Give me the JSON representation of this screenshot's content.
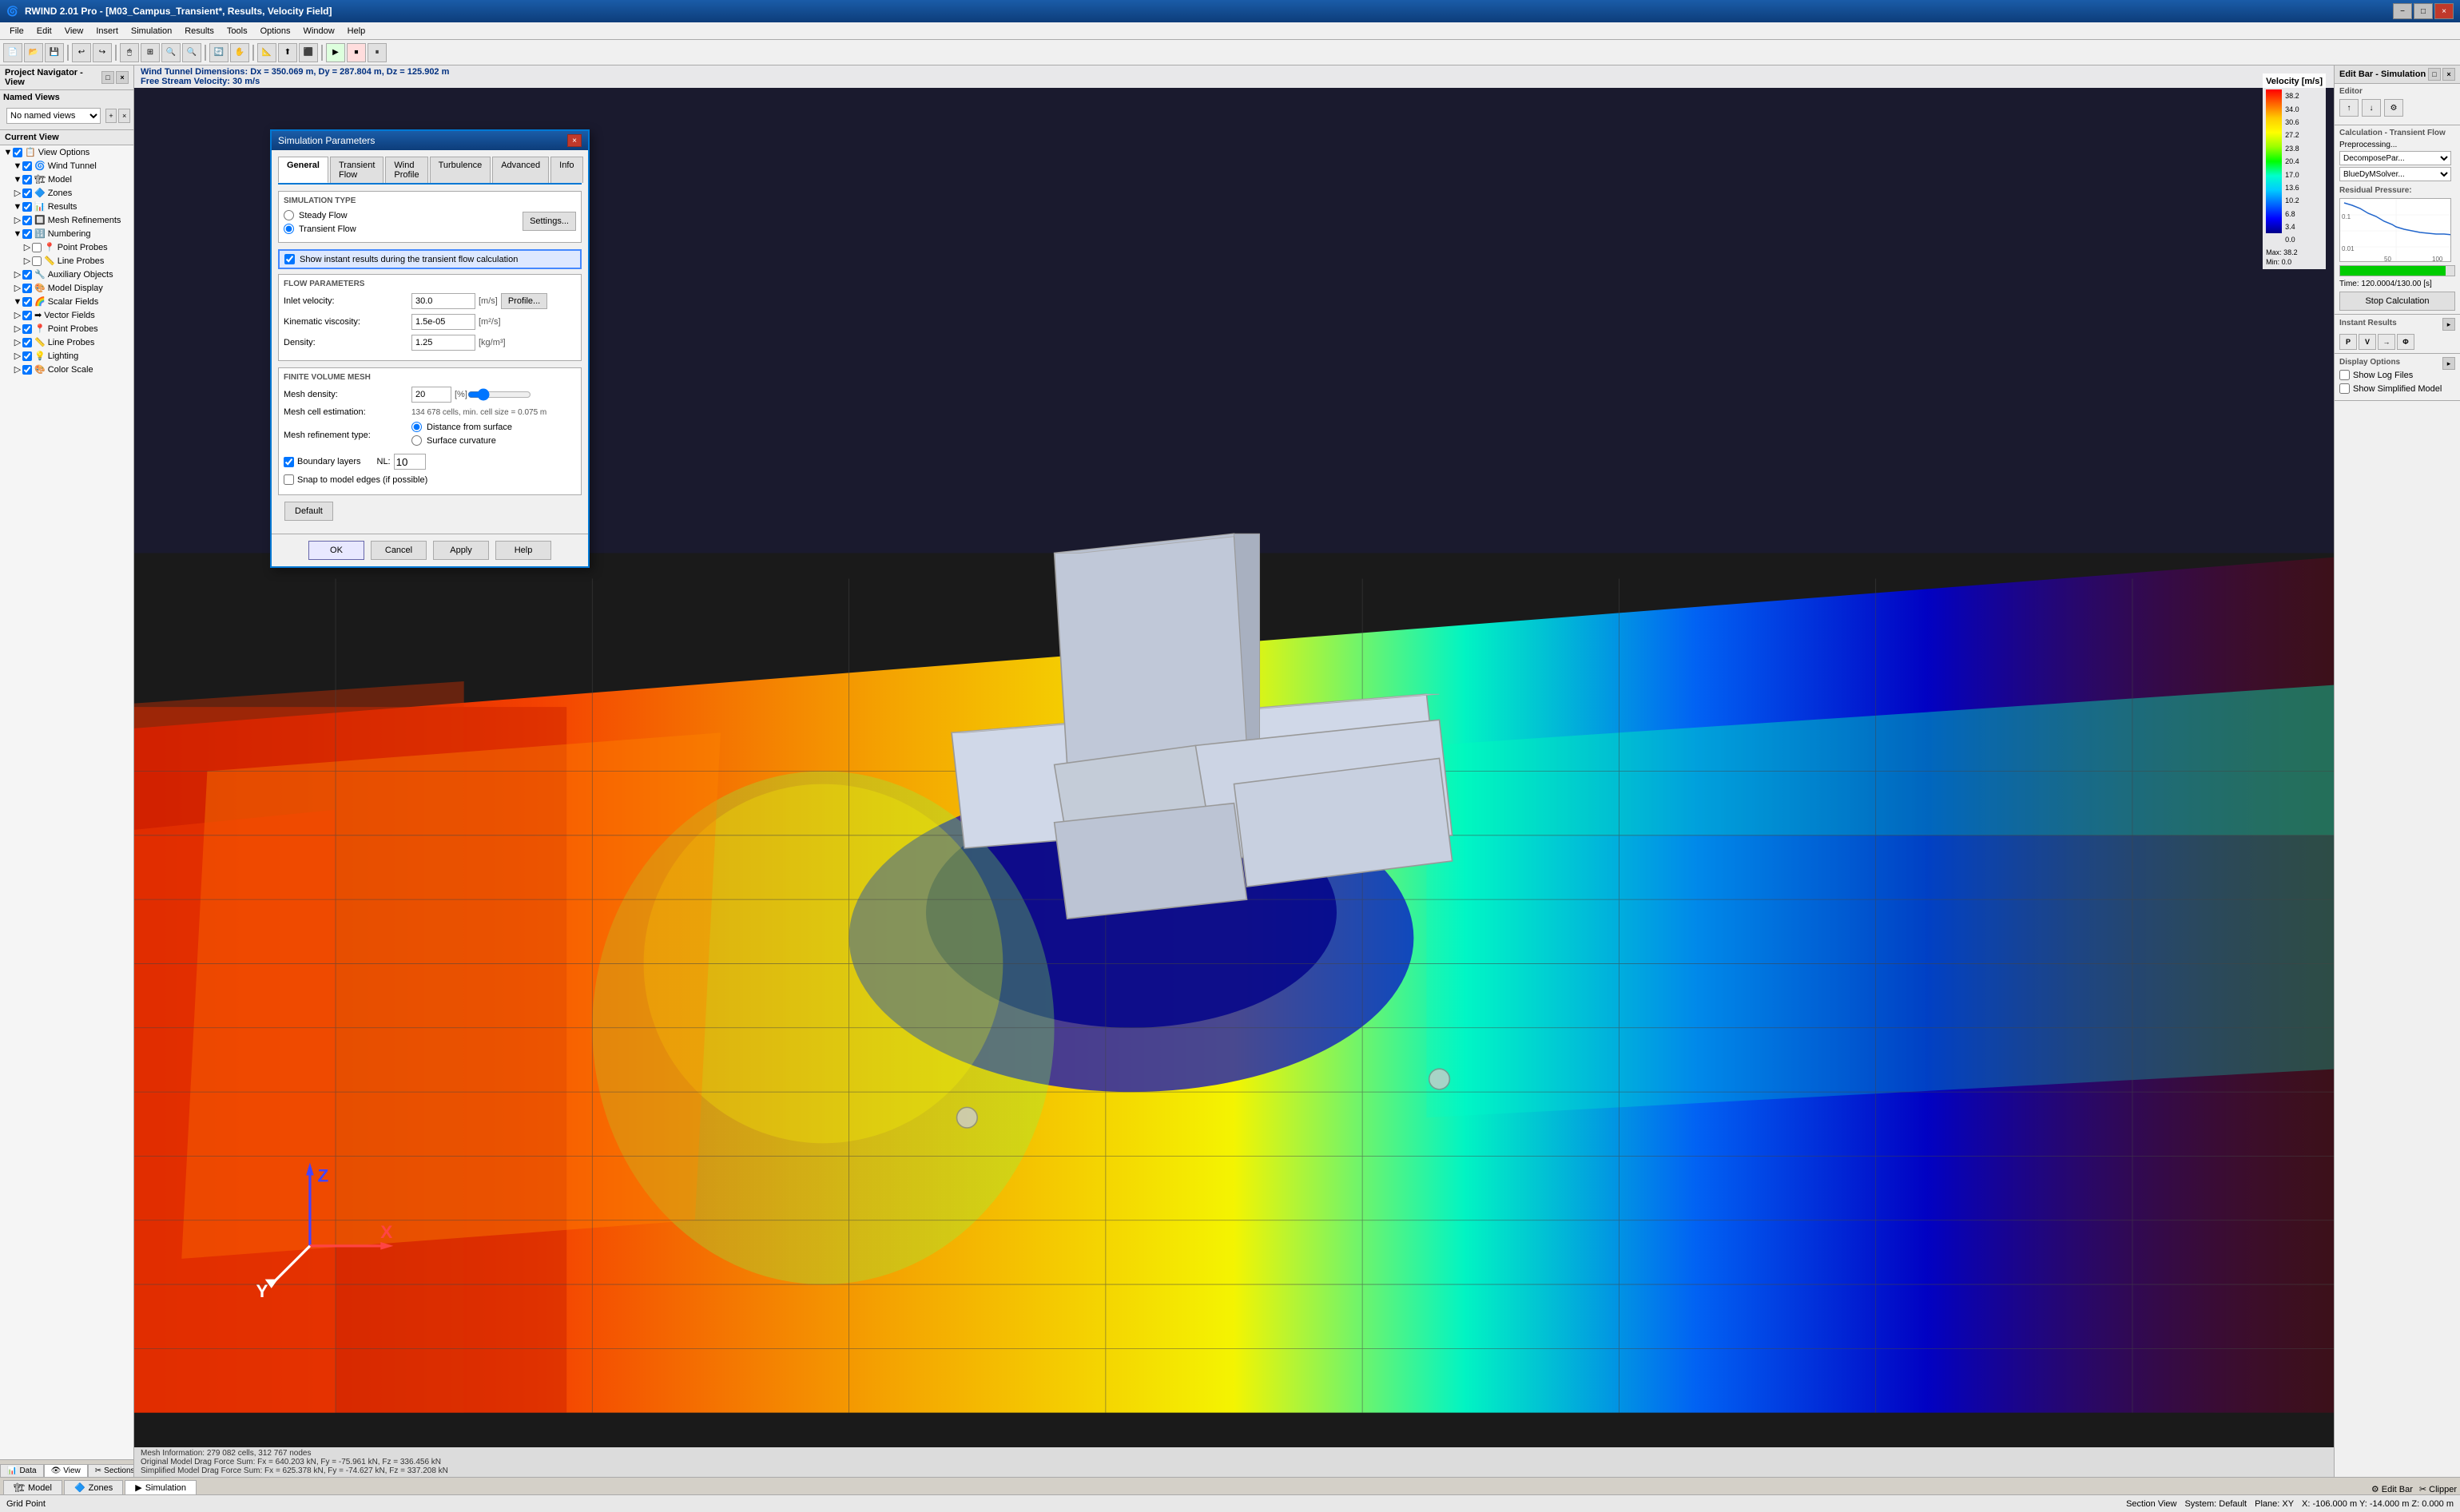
{
  "window": {
    "title": "RWIND 2.01 Pro - [M03_Campus_Transient*, Results, Velocity Field]",
    "minimize": "−",
    "maximize": "□",
    "close": "×"
  },
  "menu": {
    "items": [
      "File",
      "Edit",
      "View",
      "Insert",
      "Simulation",
      "Results",
      "Tools",
      "Options",
      "Window",
      "Help"
    ]
  },
  "info_bar": {
    "dimensions": "Wind Tunnel Dimensions: Dx = 350.069 m, Dy = 287.804 m, Dz = 125.902 m",
    "velocity": "Free Stream Velocity: 30 m/s"
  },
  "velocity_legend": {
    "title": "Velocity [m/s]",
    "values": [
      "38.2",
      "34.0",
      "30.6",
      "27.2",
      "23.8",
      "20.4",
      "17.0",
      "13.6",
      "10.2",
      "6.8",
      "3.4",
      "0.0"
    ],
    "max": "Max: 38.2",
    "min": "Min:  0.0"
  },
  "left_panel": {
    "header": "Project Navigator - View",
    "named_views_label": "Named Views",
    "named_views_value": "No named views",
    "current_view_label": "Current View",
    "tree_items": [
      {
        "label": "View Options",
        "depth": 0,
        "has_checkbox": true,
        "checked": true
      },
      {
        "label": "Wind Tunnel",
        "depth": 1,
        "has_checkbox": true,
        "checked": true
      },
      {
        "label": "Model",
        "depth": 1,
        "has_checkbox": true,
        "checked": true
      },
      {
        "label": "Zones",
        "depth": 1,
        "has_checkbox": true,
        "checked": true
      },
      {
        "label": "Results",
        "depth": 1,
        "has_checkbox": true,
        "checked": true
      },
      {
        "label": "Mesh Refinements",
        "depth": 1,
        "has_checkbox": true,
        "checked": true
      },
      {
        "label": "Numbering",
        "depth": 1,
        "has_checkbox": true,
        "checked": true
      },
      {
        "label": "Point Probes",
        "depth": 2,
        "has_checkbox": true,
        "checked": false
      },
      {
        "label": "Line Probes",
        "depth": 2,
        "has_checkbox": true,
        "checked": false
      },
      {
        "label": "Auxiliary Objects",
        "depth": 1,
        "has_checkbox": true,
        "checked": true
      },
      {
        "label": "Model Display",
        "depth": 1,
        "has_checkbox": true,
        "checked": true
      },
      {
        "label": "Scalar Fields",
        "depth": 1,
        "has_checkbox": true,
        "checked": true
      },
      {
        "label": "Vector Fields",
        "depth": 1,
        "has_checkbox": true,
        "checked": true
      },
      {
        "label": "Point Probes",
        "depth": 1,
        "has_checkbox": true,
        "checked": true
      },
      {
        "label": "Line Probes",
        "depth": 1,
        "has_checkbox": true,
        "checked": true
      },
      {
        "label": "Lighting",
        "depth": 1,
        "has_checkbox": true,
        "checked": true
      },
      {
        "label": "Color Scale",
        "depth": 1,
        "has_checkbox": true,
        "checked": true
      }
    ],
    "tabs": [
      {
        "label": "Data",
        "icon": "📊",
        "active": false
      },
      {
        "label": "View",
        "icon": "👁",
        "active": true
      },
      {
        "label": "Sections",
        "icon": "✂",
        "active": false
      }
    ]
  },
  "dialog": {
    "title": "Simulation Parameters",
    "tabs": [
      "General",
      "Transient Flow",
      "Wind Profile",
      "Turbulence",
      "Advanced",
      "Info"
    ],
    "active_tab": "General",
    "simulation_type_label": "Simulation Type",
    "radio_steady": "Steady Flow",
    "radio_transient": "Transient Flow",
    "radio_transient_selected": true,
    "settings_btn": "Settings...",
    "checkbox_instant": "Show instant results during the transient flow calculation",
    "checkbox_instant_checked": true,
    "flow_params_label": "Flow Parameters",
    "inlet_velocity_label": "Inlet velocity:",
    "inlet_velocity_value": "30.0",
    "inlet_velocity_unit": "[m/s]",
    "profile_btn": "Profile...",
    "kinematic_viscosity_label": "Kinematic viscosity:",
    "kinematic_viscosity_value": "1.5e-05",
    "kinematic_viscosity_unit": "[m²/s]",
    "density_label": "Density:",
    "density_value": "1.25",
    "density_unit": "[kg/m³]",
    "fv_mesh_label": "Finite Volume Mesh",
    "mesh_density_label": "Mesh density:",
    "mesh_density_value": "20",
    "mesh_density_unit": "[%]",
    "mesh_cell_label": "Mesh cell estimation:",
    "mesh_cell_value": "134 678 cells, min. cell size = 0.075 m",
    "mesh_refinement_label": "Mesh refinement type:",
    "radio_distance": "Distance from surface",
    "radio_surface": "Surface curvature",
    "boundary_layers_label": "Boundary layers",
    "boundary_layers_checked": true,
    "nl_label": "NL:",
    "nl_value": "10",
    "snap_label": "Snap to model edges (if possible)",
    "snap_checked": false,
    "default_btn": "Default",
    "ok_btn": "OK",
    "cancel_btn": "Cancel",
    "apply_btn": "Apply",
    "help_btn": "Help"
  },
  "right_panel": {
    "title": "Edit Bar - Simulation",
    "editor_label": "Editor",
    "calc_title": "Calculation - Transient Flow",
    "preprocessing": "Preprocessing...",
    "decompose": "DecomposePar...",
    "solver": "BlueDyMSolver...",
    "residual_label": "Residual Pressure:",
    "time_label": "Time:",
    "time_value": "120.0004/130.00 [s]",
    "stop_btn": "Stop Calculation",
    "instant_results_label": "Instant Results",
    "display_options_label": "Display Options",
    "show_log_files": "Show Log Files",
    "show_simplified": "Show Simplified Model",
    "chart_y_labels": [
      "0.1",
      "0.01"
    ],
    "chart_x_labels": [
      "50",
      "100"
    ],
    "progress_pct": 92
  },
  "bottom_tabs": [
    {
      "label": "Model",
      "icon": "🏗",
      "active": false
    },
    {
      "label": "Zones",
      "icon": "🔷",
      "active": false
    },
    {
      "label": "Simulation",
      "icon": "▶",
      "active": true
    }
  ],
  "status_bar": {
    "left": "Grid Point",
    "section_view": "Section View",
    "system": "System: Default",
    "plane": "Plane: XY",
    "coords": "X: -106.000 m   Y: -14.000 m   Z: 0.000 m",
    "edit_bar": "Edit Bar",
    "clipper": "Clipper"
  },
  "mesh_info": {
    "line1": "Mesh Information: 279 082 cells, 312 767 nodes",
    "line2": "Original Model Drag Force Sum: Fx = 640.203 kN, Fy = -75.961 kN, Fz = 336.456 kN",
    "line3": "Simplified Model Drag Force Sum: Fx = 625.378 kN, Fy = -74.627 kN, Fz = 337.208 kN"
  }
}
